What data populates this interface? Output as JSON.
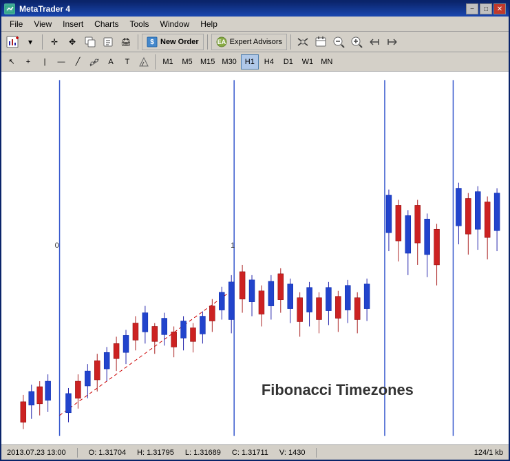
{
  "titleBar": {
    "title": "MetaTrader 4",
    "minimize": "−",
    "maximize": "□",
    "close": "✕"
  },
  "menuBar": {
    "items": [
      "File",
      "View",
      "Insert",
      "Charts",
      "Tools",
      "Window",
      "Help"
    ]
  },
  "toolbar1": {
    "newOrderLabel": "New Order",
    "expertAdvisorsLabel": "Expert Advisors"
  },
  "toolbar2": {
    "timeframes": [
      "M1",
      "M5",
      "M15",
      "M30",
      "H1",
      "H4",
      "D1",
      "W1",
      "MN"
    ],
    "activeTimeframe": "H1"
  },
  "chart": {
    "title": "Fibonacci Timezones",
    "label0": "0",
    "label1": "1"
  },
  "statusBar": {
    "datetime": "2013.07.23 13:00",
    "open": "O: 1.31704",
    "high": "H: 1.31795",
    "low": "L: 1.31689",
    "close": "C: 1.31711",
    "volume": "V: 1430",
    "info": "124/1 kb"
  }
}
